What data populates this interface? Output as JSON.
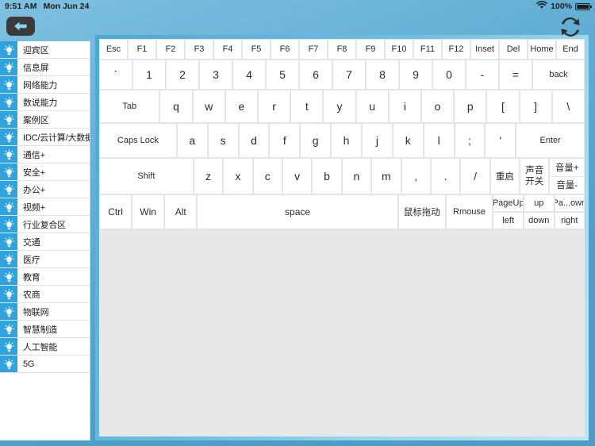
{
  "statusbar": {
    "time": "9:51 AM",
    "date": "Mon Jun 24",
    "battery_percent": "100%",
    "wifi_icon": "wifi-icon",
    "battery_icon": "battery-full-icon",
    "signal_icon": "signal-dots-icon"
  },
  "nav": {
    "back_icon": "back-arrow-icon",
    "refresh_icon": "refresh-sync-icon"
  },
  "colors": {
    "accent_blue": "#2ea3dd",
    "panel_gray": "#e8e8e8",
    "key_white": "#ffffff",
    "background_blue": "#62aed4"
  },
  "sidebar": {
    "icon": "lightbulb-icon",
    "items": [
      {
        "label": "迎宾区"
      },
      {
        "label": "信息屏"
      },
      {
        "label": "网络能力"
      },
      {
        "label": "数说能力"
      },
      {
        "label": "案例区"
      },
      {
        "label": "IDC/云计算/大数据"
      },
      {
        "label": "通信+"
      },
      {
        "label": "安全+"
      },
      {
        "label": "办公+"
      },
      {
        "label": "视频+"
      },
      {
        "label": "行业复合区"
      },
      {
        "label": "交通"
      },
      {
        "label": "医疗"
      },
      {
        "label": "教育"
      },
      {
        "label": "农商"
      },
      {
        "label": "物联网"
      },
      {
        "label": "智慧制造"
      },
      {
        "label": "人工智能"
      },
      {
        "label": "5G"
      }
    ]
  },
  "keyboard": {
    "row_function": [
      {
        "label": "Esc"
      },
      {
        "label": "F1"
      },
      {
        "label": "F2"
      },
      {
        "label": "F3"
      },
      {
        "label": "F4"
      },
      {
        "label": "F5"
      },
      {
        "label": "F6"
      },
      {
        "label": "F7"
      },
      {
        "label": "F8"
      },
      {
        "label": "F9"
      },
      {
        "label": "F10"
      },
      {
        "label": "F11"
      },
      {
        "label": "F12"
      },
      {
        "label": "Inset"
      },
      {
        "label": "Del"
      },
      {
        "label": "Home"
      },
      {
        "label": "End"
      }
    ],
    "row_numbers": [
      {
        "label": "`"
      },
      {
        "label": "1"
      },
      {
        "label": "2"
      },
      {
        "label": "3"
      },
      {
        "label": "4"
      },
      {
        "label": "5"
      },
      {
        "label": "6"
      },
      {
        "label": "7"
      },
      {
        "label": "8"
      },
      {
        "label": "9"
      },
      {
        "label": "0"
      },
      {
        "label": "-"
      },
      {
        "label": "="
      },
      {
        "label": "back"
      }
    ],
    "row_tab": [
      {
        "label": "Tab"
      },
      {
        "label": "q"
      },
      {
        "label": "w"
      },
      {
        "label": "e"
      },
      {
        "label": "r"
      },
      {
        "label": "t"
      },
      {
        "label": "y"
      },
      {
        "label": "u"
      },
      {
        "label": "i"
      },
      {
        "label": "o"
      },
      {
        "label": "p"
      },
      {
        "label": "["
      },
      {
        "label": "]"
      },
      {
        "label": "\\"
      }
    ],
    "row_caps": [
      {
        "label": "Caps Lock"
      },
      {
        "label": "a"
      },
      {
        "label": "s"
      },
      {
        "label": "d"
      },
      {
        "label": "f"
      },
      {
        "label": "g"
      },
      {
        "label": "h"
      },
      {
        "label": "j"
      },
      {
        "label": "k"
      },
      {
        "label": "l"
      },
      {
        "label": ";"
      },
      {
        "label": "'"
      },
      {
        "label": "Enter"
      }
    ],
    "row_shift": [
      {
        "label": "Shift"
      },
      {
        "label": "z"
      },
      {
        "label": "x"
      },
      {
        "label": "c"
      },
      {
        "label": "v"
      },
      {
        "label": "b"
      },
      {
        "label": "n"
      },
      {
        "label": "m"
      },
      {
        "label": ","
      },
      {
        "label": "."
      },
      {
        "label": "/"
      },
      {
        "label": "重启"
      }
    ],
    "sound_toggle_line1": "声音",
    "sound_toggle_line2": "开关",
    "volume_up": "音量+",
    "volume_down": "音量-",
    "row_bottom": [
      {
        "label": "Ctrl"
      },
      {
        "label": "Win"
      },
      {
        "label": "Alt"
      },
      {
        "label": "space"
      },
      {
        "label": "鼠标拖动"
      },
      {
        "label": "Rmouse"
      }
    ],
    "nav_grid": {
      "top": [
        "PageUp",
        "up",
        "Pa...own"
      ],
      "bottom": [
        "left",
        "down",
        "right"
      ]
    }
  }
}
